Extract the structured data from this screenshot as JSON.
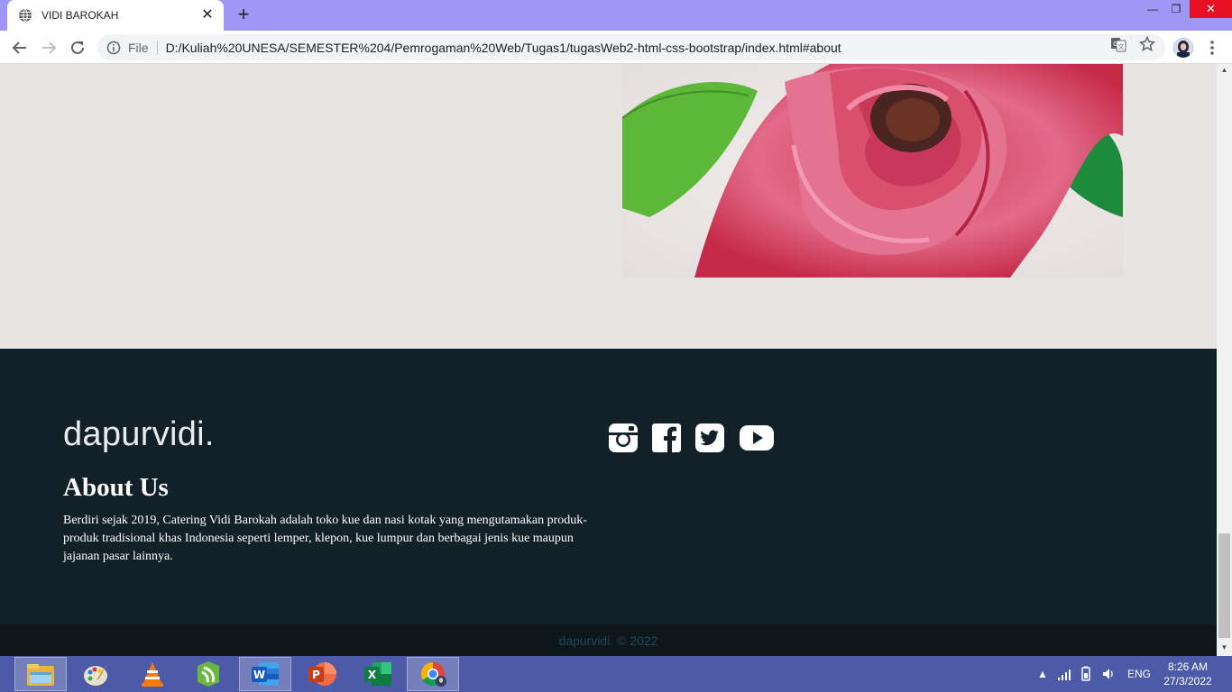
{
  "browser": {
    "tab_title": "VIDI BAROKAH",
    "address_prefix": "File",
    "url": "D:/Kuliah%20UNESA/SEMESTER%204/Pemrogaman%20Web/Tugas1/tugasWeb2-html-css-bootstrap/index.html#about"
  },
  "footer": {
    "brand": "dapurvidi.",
    "about_title": "About Us",
    "about_text": "Berdiri sejak 2019, Catering Vidi Barokah adalah toko kue dan nasi kotak yang mengutamakan produk-produk tradisional khas Indonesia seperti lemper, klepon, kue lumpur dan berbagai jenis kue maupun jajanan pasar lainnya.",
    "social_icons": [
      "instagram-icon",
      "facebook-icon",
      "twitter-icon",
      "youtube-icon"
    ],
    "copyright": "dapurvidi. © 2022"
  },
  "taskbar": {
    "apps": [
      "file-explorer-icon",
      "paint-icon",
      "vlc-icon",
      "camtasia-icon",
      "word-icon",
      "powerpoint-icon",
      "excel-icon",
      "chrome-icon"
    ],
    "language": "ENG",
    "time": "8:26 AM",
    "date": "27/3/2022"
  },
  "colors": {
    "page_bg": "#e8e4e4",
    "footer_bg": "#122028",
    "footer_bottom_bg": "#0d161a",
    "tabbar_bg": "#9e98f4",
    "taskbar_bg": "#4c5aa8"
  }
}
